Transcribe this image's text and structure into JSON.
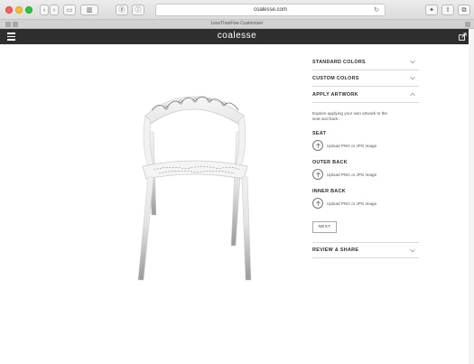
{
  "browser": {
    "address": "coalesse.com",
    "tab_title": "LessThanFive Customizer"
  },
  "site": {
    "logo": "coalesse"
  },
  "panel": {
    "standard_colors": "STANDARD COLORS",
    "custom_colors": "CUSTOM COLORS",
    "apply_artwork": "APPLY ARTWORK",
    "description": "Explore applying your own artwork to the seat and back.",
    "sections": [
      {
        "title": "SEAT",
        "upload": "Upload PNG or JPG image"
      },
      {
        "title": "OUTER BACK",
        "upload": "Upload PNG or JPG image"
      },
      {
        "title": "INNER BACK",
        "upload": "Upload PNG or JPG image"
      }
    ],
    "next": "NEXT",
    "review_share": "REVIEW & SHARE"
  },
  "icons": {
    "hamburger": "hamburger-menu-icon",
    "share": "share-icon",
    "chevron": "chevron-icon",
    "upload": "upload-arrow-icon"
  },
  "colors": {
    "header": "#2e2e2e",
    "chair": "#f2f2f2"
  }
}
